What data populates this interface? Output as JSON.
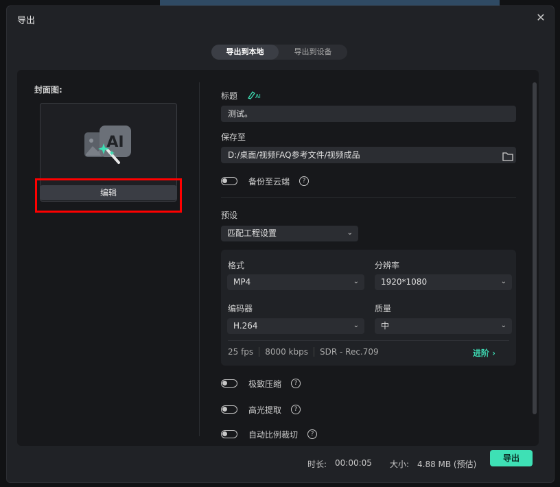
{
  "dialog": {
    "title": "导出",
    "close_icon": "close-icon"
  },
  "tabs": [
    {
      "label": "导出到本地",
      "active": true
    },
    {
      "label": "导出到设备",
      "active": false
    }
  ],
  "cover": {
    "label": "封面图:",
    "edit_label": "编辑",
    "ai_text": "AI"
  },
  "title_field": {
    "label": "标题",
    "ai_badge": "AI",
    "value": "测试。"
  },
  "save_to": {
    "label": "保存至",
    "path": "D:/桌面/视频FAQ参考文件/视频成品"
  },
  "backup": {
    "label": "备份至云端",
    "on": false
  },
  "preset": {
    "label": "预设",
    "value": "匹配工程设置"
  },
  "settings": {
    "format_label": "格式",
    "format_value": "MP4",
    "resolution_label": "分辨率",
    "resolution_value": "1920*1080",
    "encoder_label": "编码器",
    "encoder_value": "H.264",
    "quality_label": "质量",
    "quality_value": "中",
    "fps": "25 fps",
    "bitrate": "8000 kbps",
    "color": "SDR - Rec.709",
    "advanced_label": "进阶 ›"
  },
  "options": [
    {
      "label": "极致压缩",
      "on": false
    },
    {
      "label": "高光提取",
      "on": false
    },
    {
      "label": "自动比例裁切",
      "on": false
    }
  ],
  "footer": {
    "duration_label": "时长:",
    "duration_value": "00:00:05",
    "size_label": "大小:",
    "size_value": "4.88 MB (预估)",
    "export_label": "导出"
  },
  "colors": {
    "accent": "#3ee0b5",
    "highlight": "#ff0000"
  }
}
